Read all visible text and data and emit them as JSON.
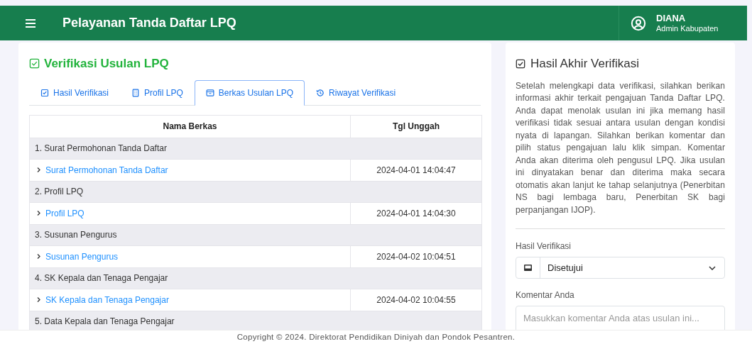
{
  "header": {
    "title": "Pelayanan Tanda Daftar LPQ",
    "user": {
      "name": "DIANA",
      "role": "Admin Kabupaten"
    }
  },
  "main": {
    "title": "Verifikasi Usulan LPQ",
    "tabs": [
      {
        "label": "Hasil Verifikasi",
        "selected": false
      },
      {
        "label": "Profil LPQ",
        "selected": false
      },
      {
        "label": "Berkas Usulan LPQ",
        "selected": true
      },
      {
        "label": "Riwayat Verifikasi",
        "selected": false
      }
    ],
    "table": {
      "columns": [
        "Nama Berkas",
        "Tgl Unggah"
      ],
      "groups": [
        {
          "title": "1. Surat Permohonan Tanda Daftar",
          "files": [
            {
              "name": "Surat Permohonan Tanda Daftar",
              "date": "2024-04-01 14:04:47"
            }
          ]
        },
        {
          "title": "2. Profil LPQ",
          "files": [
            {
              "name": "Profil LPQ",
              "date": "2024-04-01 14:04:30"
            }
          ]
        },
        {
          "title": "3. Susunan Pengurus",
          "files": [
            {
              "name": "Susunan Pengurus",
              "date": "2024-04-02 10:04:51"
            }
          ]
        },
        {
          "title": "4. SK Kepala dan Tenaga Pengajar",
          "files": [
            {
              "name": "SK Kepala dan Tenaga Pengajar",
              "date": "2024-04-02 10:04:55"
            }
          ]
        },
        {
          "title": "5. Data Kepala dan Tenaga Pengajar"
        }
      ]
    }
  },
  "panel": {
    "title": "Hasil Akhir Verifikasi",
    "description": "Setelah melengkapi data verifikasi, silahkan berikan informasi akhir terkait pengajuan Tanda Daftar LPQ. Anda dapat menolak usulan ini jika memang hasil verifikasi tidak sesuai antara usulan dengan kondisi nyata di lapangan. Silahkan berikan komentar dan pilih status pengajuan lalu klik simpan. Komentar Anda akan diterima oleh pengusul LPQ. Jika usulan ini dinyatakan benar dan diterima maka secara otomatis akan lanjut ke tahap selanjutnya (Penerbitan NS bagi lembaga baru, Penerbitan SK bagi perpanjangan IJOP).",
    "result": {
      "label": "Hasil Verifikasi",
      "value": "Disetujui"
    },
    "comment": {
      "label": "Komentar Anda",
      "placeholder": "Masukkan komentar Anda atas usulan ini..."
    }
  },
  "footer": "Copyright © 2024. Direktorat Pendidikan Diniyah dan Pondok Pesantren."
}
